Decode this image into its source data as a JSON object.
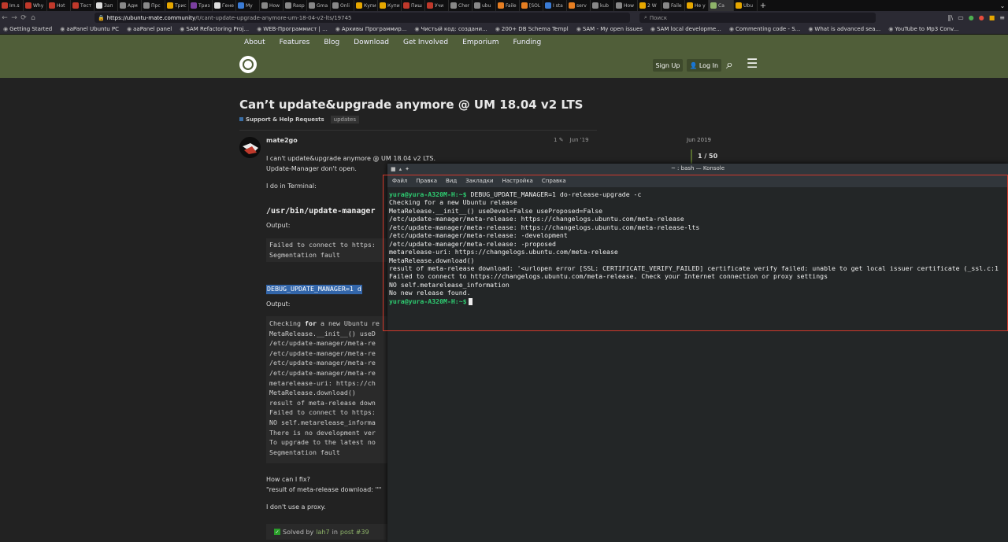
{
  "browser": {
    "tabs": [
      {
        "label": "Im.s",
        "color": "#c0392b"
      },
      {
        "label": "Why",
        "color": "#c0392b"
      },
      {
        "label": "Hot",
        "color": "#c0392b"
      },
      {
        "label": "Тест",
        "color": "#c0392b"
      },
      {
        "label": "Зап",
        "color": "#dddddd"
      },
      {
        "label": "Адм",
        "color": "#888888"
      },
      {
        "label": "Прс",
        "color": "#888888"
      },
      {
        "label": "Трис",
        "color": "#e6a700"
      },
      {
        "label": "Триз",
        "color": "#7b3fa0"
      },
      {
        "label": "Гене",
        "color": "#dddddd"
      },
      {
        "label": "My",
        "color": "#3a7bd5"
      },
      {
        "label": "How",
        "color": "#888888"
      },
      {
        "label": "Rasp",
        "color": "#888888"
      },
      {
        "label": "Gma",
        "color": "#888888"
      },
      {
        "label": "Onli",
        "color": "#888888"
      },
      {
        "label": "Купи",
        "color": "#e6a700"
      },
      {
        "label": "Купи",
        "color": "#e6a700"
      },
      {
        "label": "Пиш",
        "color": "#c0392b"
      },
      {
        "label": "Учи",
        "color": "#c0392b"
      },
      {
        "label": "Cher",
        "color": "#888888"
      },
      {
        "label": "ubu",
        "color": "#888888"
      },
      {
        "label": "Faile",
        "color": "#e67e22"
      },
      {
        "label": "[SOL",
        "color": "#e67e22"
      },
      {
        "label": "I sta",
        "color": "#3a7bd5"
      },
      {
        "label": "serv",
        "color": "#e67e22"
      },
      {
        "label": "kub",
        "color": "#888888"
      },
      {
        "label": "How",
        "color": "#888888"
      },
      {
        "label": "2 W",
        "color": "#e6a700"
      },
      {
        "label": "Faile",
        "color": "#888888"
      },
      {
        "label": "He y",
        "color": "#e6a700"
      },
      {
        "label": "Ca",
        "color": "#8fb46a"
      },
      {
        "label": "Ubu",
        "color": "#e6a700"
      }
    ],
    "active_tab_index": 30,
    "url_host": "https://ubuntu-mate.community",
    "url_path": "/t/cant-update-upgrade-anymore-um-18-04-v2-lts/19745",
    "search_placeholder": "Поиск",
    "bookmarks": [
      "Getting Started",
      "aaPanel Ubuntu PC",
      "aaPanel panel",
      "SAM Refactoring Proj...",
      "WEB-Программист | ...",
      "Архивы Программир...",
      "Чистый код: создани...",
      "200+ DB Schema Templ",
      "SAM - My open issues",
      "SAM local developme...",
      "Commenting code - S...",
      "What is advanced sea...",
      "YouTube to Mp3 Conv..."
    ]
  },
  "site": {
    "nav": [
      "About",
      "Features",
      "Blog",
      "Download",
      "Get Involved",
      "Emporium",
      "Funding"
    ],
    "signup_label": "Sign Up",
    "login_label": "Log In"
  },
  "topic": {
    "title": "Can’t update&upgrade anymore @ UM 18.04 v2 LTS",
    "category": "Support & Help Requests",
    "tag": "updates"
  },
  "post": {
    "username": "mate2go",
    "edits": "1",
    "date": "Jun '19",
    "line1": "I can't update&upgrade anymore @ UM 18.04 v2 LTS.",
    "line2": "Update-Manager don't open.",
    "line3": "I do in Terminal:",
    "heading_code": "/usr/bin/update-manager",
    "output_label_1": "Output:",
    "code1": [
      "Failed to connect to https:",
      "Segmentation fault"
    ],
    "highlight_code": "DEBUG_UPDATE_MANAGER=1 d",
    "output_label_2": "Output:",
    "code2_first_keyword": "for",
    "code2_first_prefix": "Checking ",
    "code2_first_suffix": " a new Ubuntu re",
    "code2": [
      "MetaRelease.__init__() useD",
      "/etc/update-manager/meta-re",
      "/etc/update-manager/meta-re",
      "/etc/update-manager/meta-re",
      "/etc/update-manager/meta-re",
      "metarelease-uri: https://ch",
      "MetaRelease.download()",
      "result of meta-release down",
      "Failed to connect to https:",
      "NO self.metarelease_informa",
      "There is no development ver",
      "To upgrade to the latest no",
      "Segmentation fault"
    ],
    "question": "How can I fix?",
    "quote": "\"result of meta-release download: '\"'",
    "proxy": "I don't use a proxy.",
    "solved_prefix": "Solved by",
    "solved_user": "lah7",
    "solved_mid": "in",
    "solved_post": "post #39"
  },
  "timeline": {
    "date": "Jun 2019",
    "count": "1 / 50"
  },
  "konsole": {
    "title": "~ : bash — Konsole",
    "menu": [
      "Файл",
      "Правка",
      "Вид",
      "Закладки",
      "Настройка",
      "Справка"
    ],
    "prompt": "yura@yura-A320M-H:~$",
    "command": " DEBUG_UPDATE_MANAGER=1 do-release-upgrade -c",
    "output": [
      "Checking for a new Ubuntu release",
      "MetaRelease.__init__() useDevel=False useProposed=False",
      "/etc/update-manager/meta-release: https://changelogs.ubuntu.com/meta-release",
      "/etc/update-manager/meta-release: https://changelogs.ubuntu.com/meta-release-lts",
      "/etc/update-manager/meta-release: -development",
      "/etc/update-manager/meta-release: -proposed",
      "metarelease-uri: https://changelogs.ubuntu.com/meta-release",
      "MetaRelease.download()",
      "result of meta-release download: '<urlopen error [SSL: CERTIFICATE_VERIFY_FAILED] certificate verify failed: unable to get local issuer certificate (_ssl.c:1",
      "Failed to connect to https://changelogs.ubuntu.com/meta-release. Check your Internet connection or proxy settings",
      "NO self.metarelease_information",
      "No new release found."
    ],
    "final_prompt": "yura@yura-A320M-H:~$"
  },
  "colors": {
    "site_header": "#505e39",
    "prompt_green": "#2ecc71",
    "highlight_box": "#d0392b",
    "selection_blue": "#3366aa"
  }
}
